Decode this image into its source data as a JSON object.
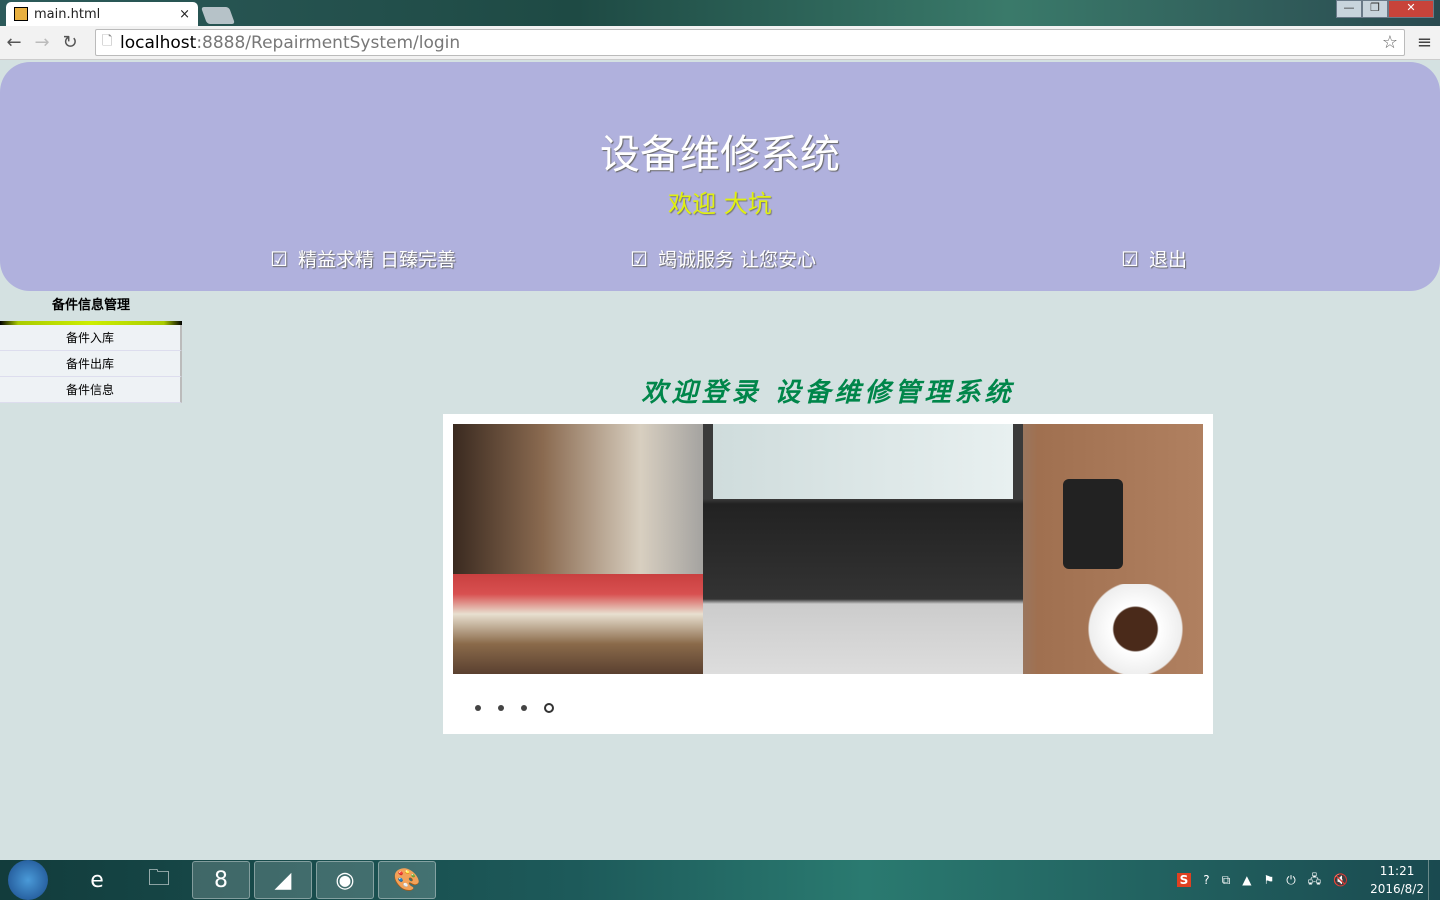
{
  "browser": {
    "tab_title": "main.html",
    "url_host": "localhost",
    "url_rest": ":8888/RepairmentSystem/login"
  },
  "header": {
    "title": "设备维修系统",
    "welcome": "欢迎  大坑",
    "links": [
      "精益求精  日臻完善",
      "竭诚服务  让您安心",
      "退出"
    ]
  },
  "sidebar": {
    "title": "备件信息管理",
    "items": [
      "备件入库",
      "备件出库",
      "备件信息"
    ]
  },
  "main": {
    "title": "欢迎登录 设备维修管理系统",
    "carousel": {
      "slide_count": 4,
      "active_index": 3
    }
  },
  "taskbar": {
    "time": "11:21",
    "date": "2016/8/2"
  },
  "colors": {
    "header_bg": "#b0b1dd",
    "welcome": "#e0f010",
    "main_title": "#00864a",
    "page_bg": "#d4e1e1"
  }
}
